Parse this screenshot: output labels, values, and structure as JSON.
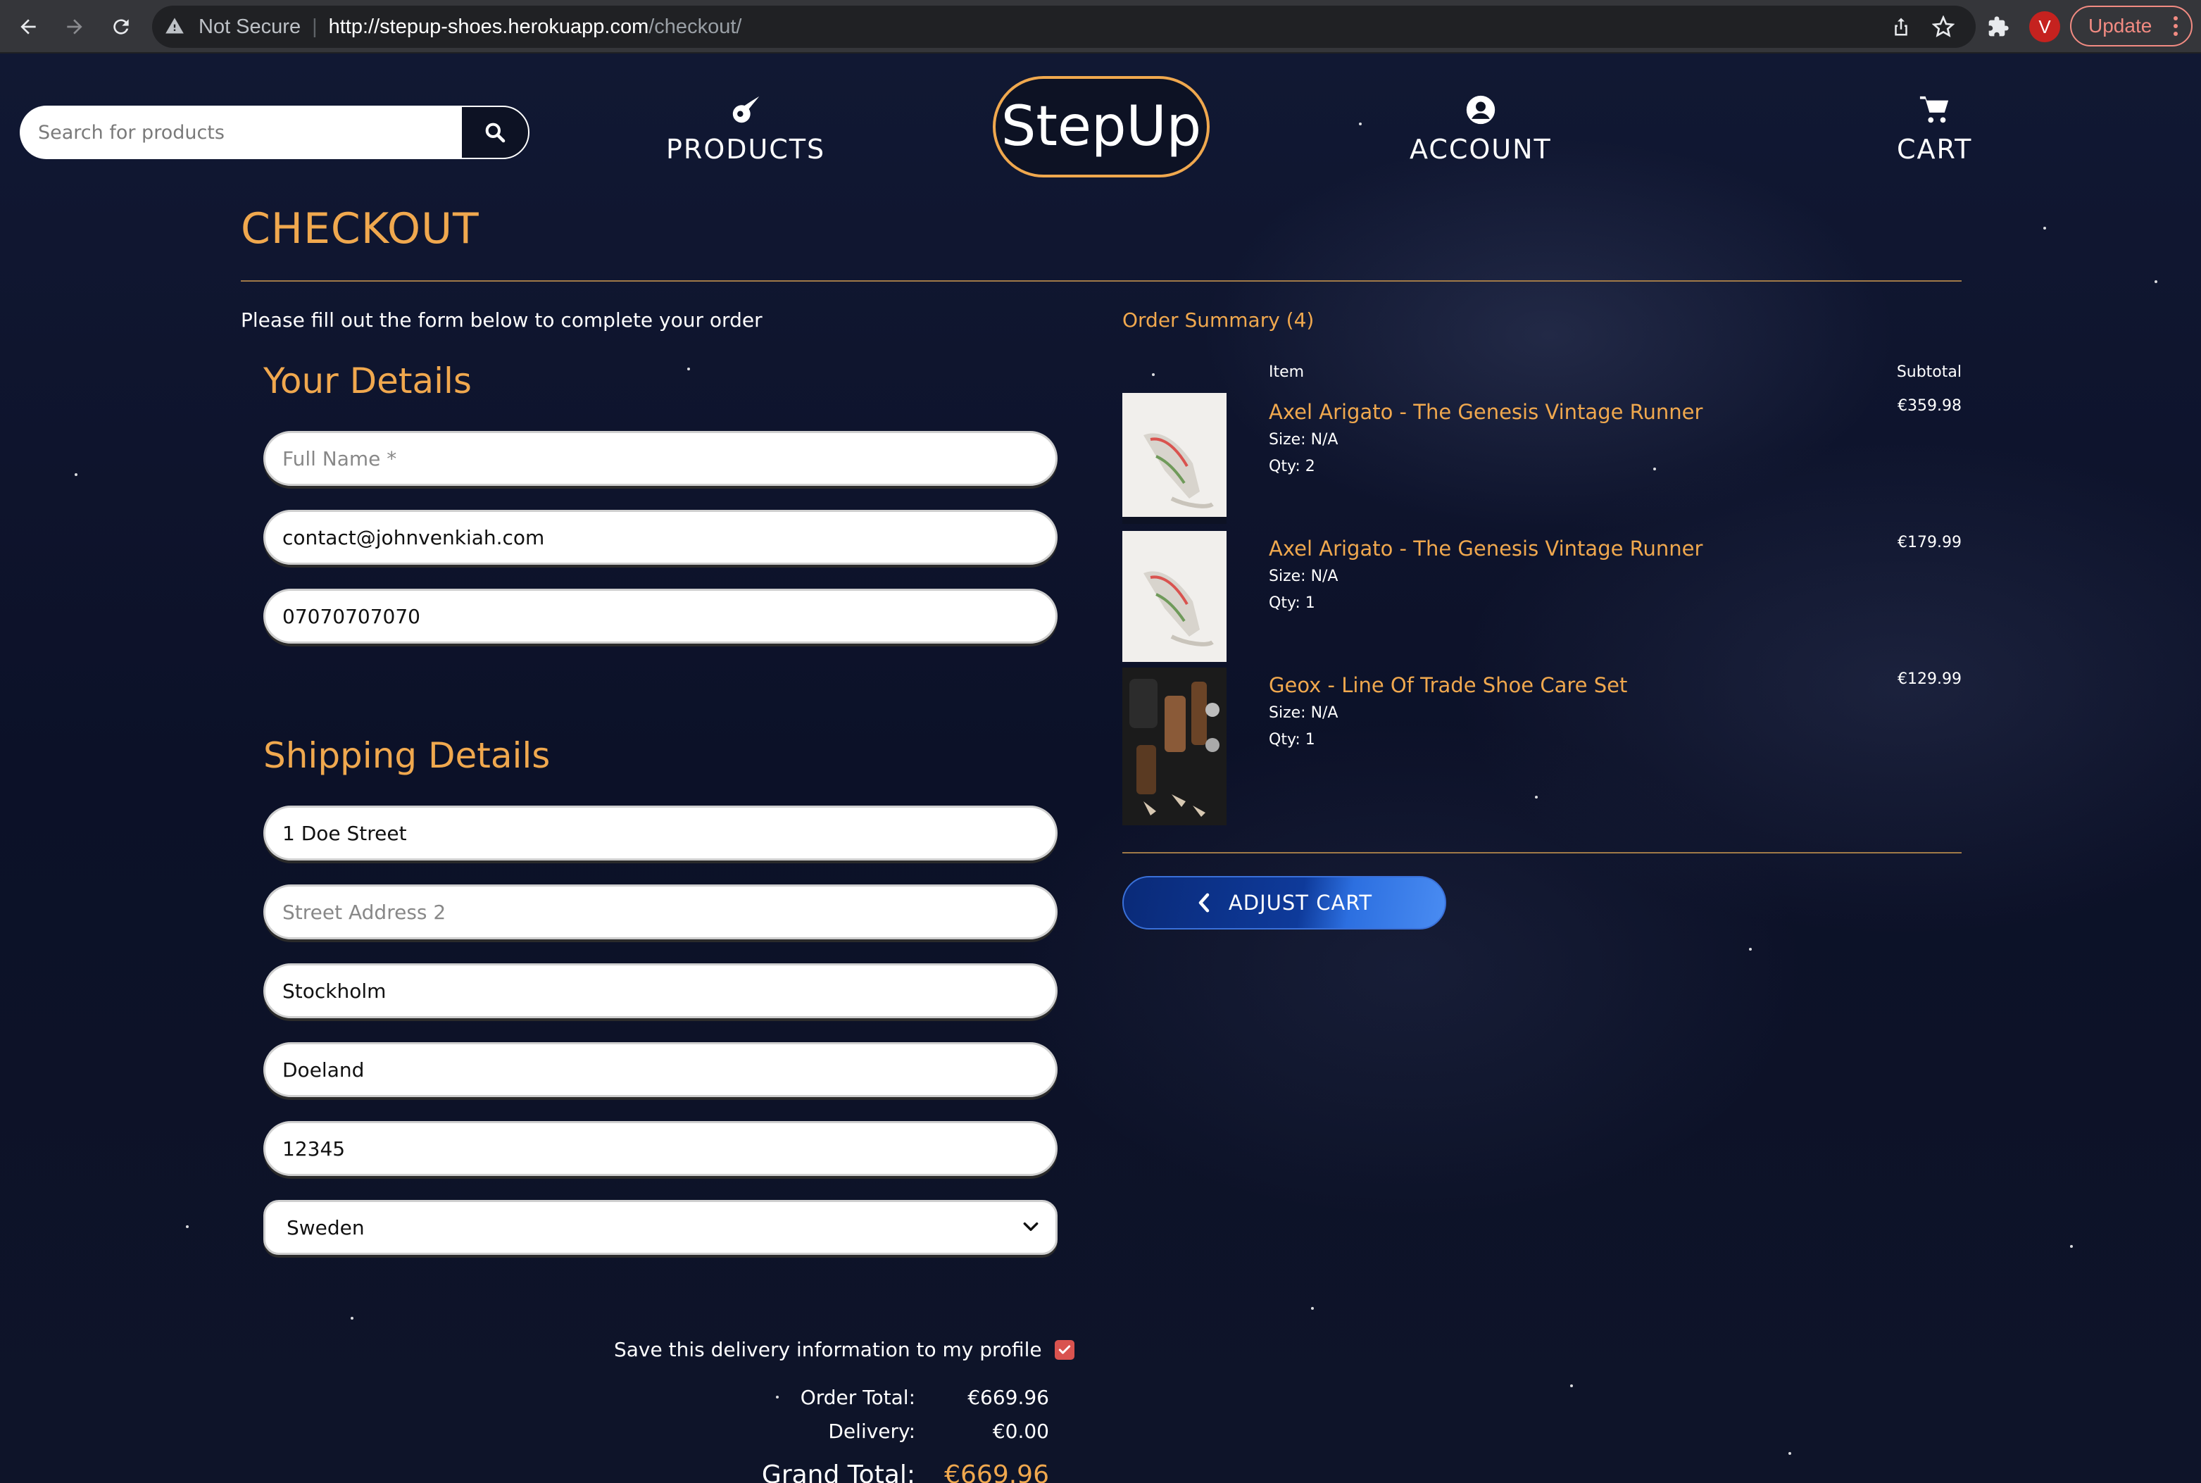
{
  "browser": {
    "security_label": "Not Secure",
    "url_host": "http://stepup-shoes.herokuapp.com",
    "url_path": "/checkout/",
    "profile_initial": "V",
    "update_label": "Update"
  },
  "header": {
    "search_placeholder": "Search for products",
    "logo": "StepUp",
    "nav": {
      "products": "PRODUCTS",
      "account": "ACCOUNT",
      "cart": "CART"
    }
  },
  "checkout": {
    "title": "CHECKOUT",
    "intro": "Please fill out the form below to complete your order",
    "your_details_title": "Your Details",
    "full_name": {
      "value": "",
      "placeholder": "Full Name *"
    },
    "email": {
      "value": "contact@johnvenkiah.com"
    },
    "phone": {
      "value": "07070707070"
    },
    "shipping_title": "Shipping Details",
    "street1": {
      "value": "1 Doe Street"
    },
    "street2": {
      "value": "",
      "placeholder": "Street Address 2"
    },
    "city": {
      "value": "Stockholm"
    },
    "county": {
      "value": "Doeland"
    },
    "postcode": {
      "value": "12345"
    },
    "country": {
      "selected": "Sweden"
    },
    "save_info_label": "Save this delivery information to my profile",
    "save_info_checked": true,
    "order_total_label": "Order Total:",
    "order_total": "€669.96",
    "delivery_label": "Delivery:",
    "delivery": "€0.00",
    "grand_total_label": "Grand Total:",
    "grand_total": "€669.96"
  },
  "summary": {
    "title": "Order Summary (4)",
    "col_item": "Item",
    "col_subtotal": "Subtotal",
    "items": [
      {
        "name": "Axel Arigato - The Genesis Vintage Runner",
        "size": "Size: N/A",
        "qty": "Qty: 2",
        "subtotal": "€359.98"
      },
      {
        "name": "Axel Arigato - The Genesis Vintage Runner",
        "size": "Size: N/A",
        "qty": "Qty: 1",
        "subtotal": "€179.99"
      },
      {
        "name": "Geox - Line Of Trade Shoe Care Set",
        "size": "Size: N/A",
        "qty": "Qty: 1",
        "subtotal": "€129.99"
      }
    ],
    "adjust_label": "ADJUST CART"
  },
  "colors": {
    "accent": "#f0a84e",
    "background": "#0d1224",
    "button_blue": "#0e3a9a",
    "checkbox": "#d9534f"
  }
}
